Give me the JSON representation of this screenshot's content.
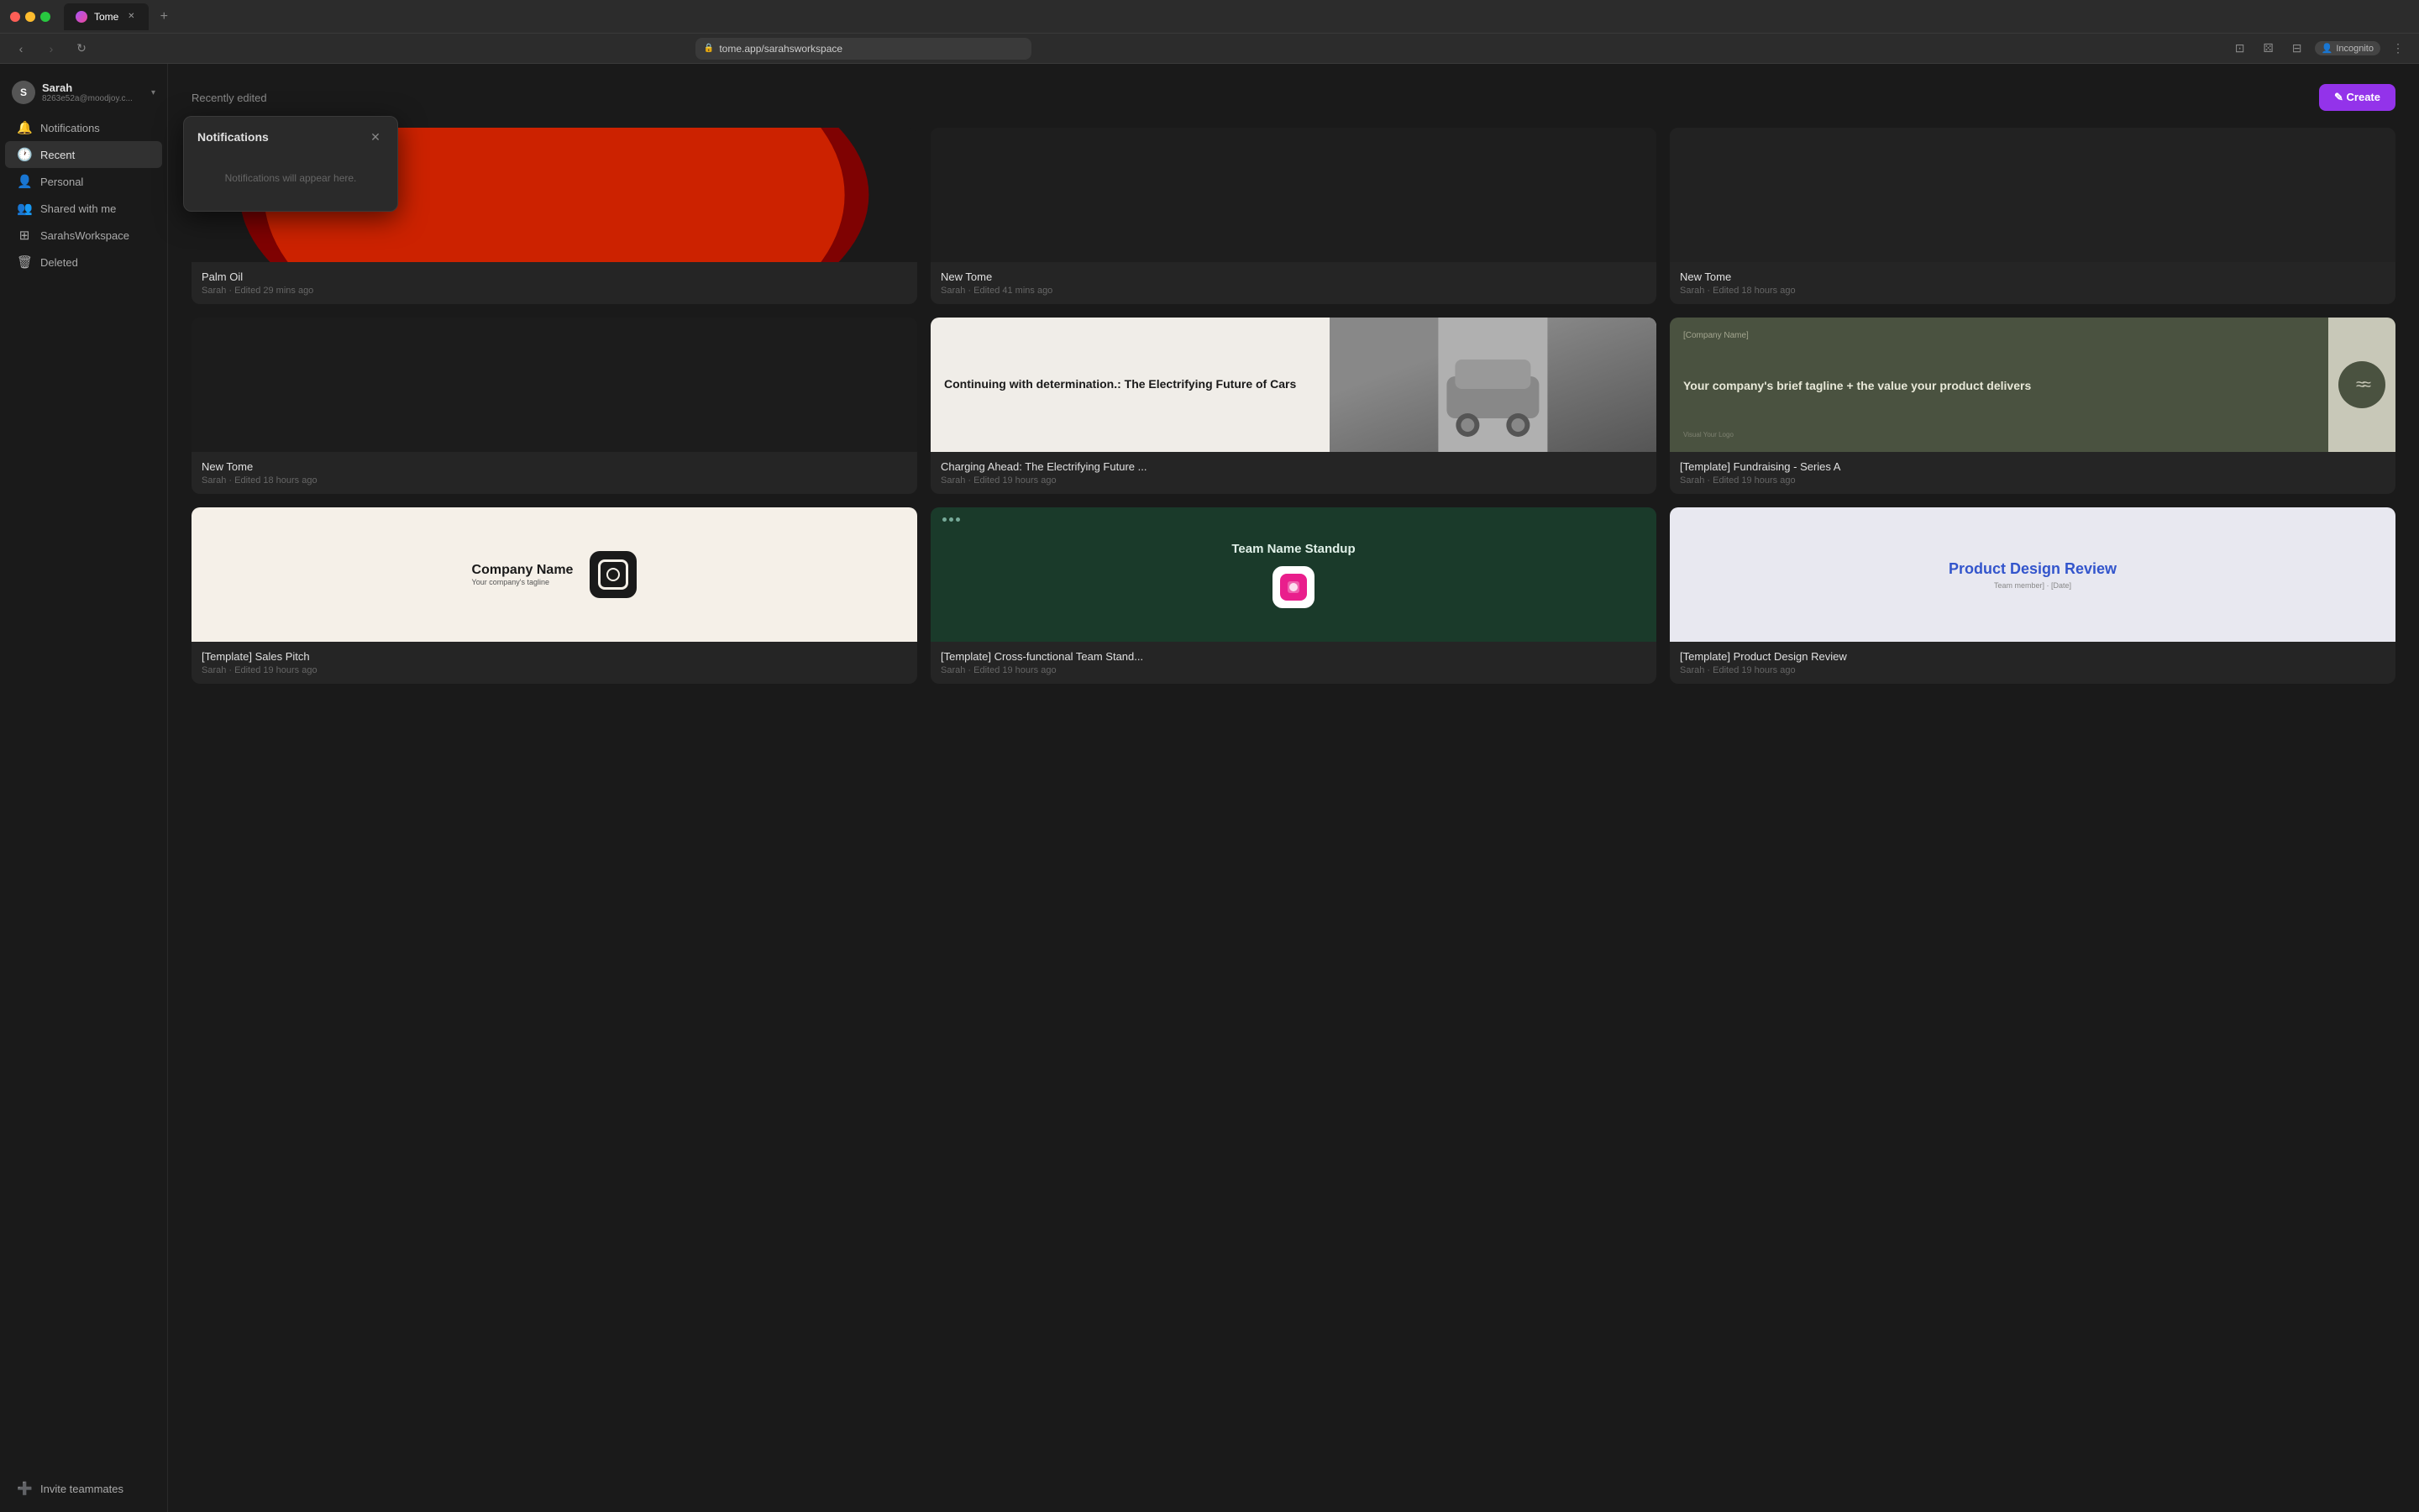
{
  "browser": {
    "tab_title": "Tome",
    "tab_favicon": "tome-favicon",
    "address": "tome.app/sarahsworkspace",
    "incognito_label": "Incognito"
  },
  "sidebar": {
    "user": {
      "name": "Sarah",
      "email": "8263e52a@moodjoy.c...",
      "avatar_letter": "S"
    },
    "items": [
      {
        "id": "notifications",
        "label": "Notifications",
        "icon": "🔔"
      },
      {
        "id": "recent",
        "label": "Recent",
        "icon": "🕐"
      },
      {
        "id": "personal",
        "label": "Personal",
        "icon": "👤"
      },
      {
        "id": "shared",
        "label": "Shared with me",
        "icon": "👥"
      },
      {
        "id": "workspace",
        "label": "SarahsWorkspace",
        "icon": "⊞"
      },
      {
        "id": "deleted",
        "label": "Deleted",
        "icon": "🗑"
      }
    ],
    "invite_label": "Invite teammates",
    "chevron": "▾"
  },
  "main": {
    "section_title": "Recently edited",
    "create_label": "✎  Create"
  },
  "notifications_popup": {
    "title": "Notifications",
    "close_label": "✕",
    "empty_message": "Notifications will appear here."
  },
  "cards": [
    {
      "id": "palm-oil",
      "title": "Palm Oil",
      "subtitle": "Sarah · Edited 29 mins ago",
      "thumb_type": "palm-oil"
    },
    {
      "id": "new-tome-1",
      "title": "New Tome",
      "subtitle": "Sarah · Edited 41 mins ago",
      "thumb_type": "dark"
    },
    {
      "id": "new-tome-2",
      "title": "New Tome",
      "subtitle": "Sarah · Edited 18 hours ago",
      "thumb_type": "dark2"
    },
    {
      "id": "new-tome-3",
      "title": "New Tome",
      "subtitle": "Sarah · Edited 18 hours ago",
      "thumb_type": "dark3"
    },
    {
      "id": "charging",
      "title": "Charging Ahead: The Electrifying Future ...",
      "subtitle": "Sarah · Edited 19 hours ago",
      "thumb_type": "charging",
      "thumb_text": "Continuing with determination.: The Electrifying Future of Cars"
    },
    {
      "id": "fundraising",
      "title": "[Template] Fundraising - Series A",
      "subtitle": "Sarah · Edited 19 hours ago",
      "thumb_type": "fundraising",
      "thumb_company": "[Company Name]",
      "thumb_tagline": "Your company's brief tagline + the value your product delivers",
      "thumb_sublabel": "Visual Your Logo"
    },
    {
      "id": "sales-pitch",
      "title": "[Template] Sales Pitch",
      "subtitle": "Sarah · Edited 19 hours ago",
      "thumb_type": "sales-pitch",
      "thumb_company": "Company Name",
      "thumb_tagline": "Your company's tagline"
    },
    {
      "id": "standup",
      "title": "[Template] Cross-functional Team Stand...",
      "subtitle": "Sarah · Edited 19 hours ago",
      "thumb_type": "standup",
      "thumb_title": "Team Name Standup"
    },
    {
      "id": "design-review",
      "title": "[Template] Product Design Review",
      "subtitle": "Sarah · Edited 19 hours ago",
      "thumb_type": "design-review",
      "thumb_title": "Product Design Review",
      "thumb_sub": "Team member] · [Date]"
    }
  ]
}
